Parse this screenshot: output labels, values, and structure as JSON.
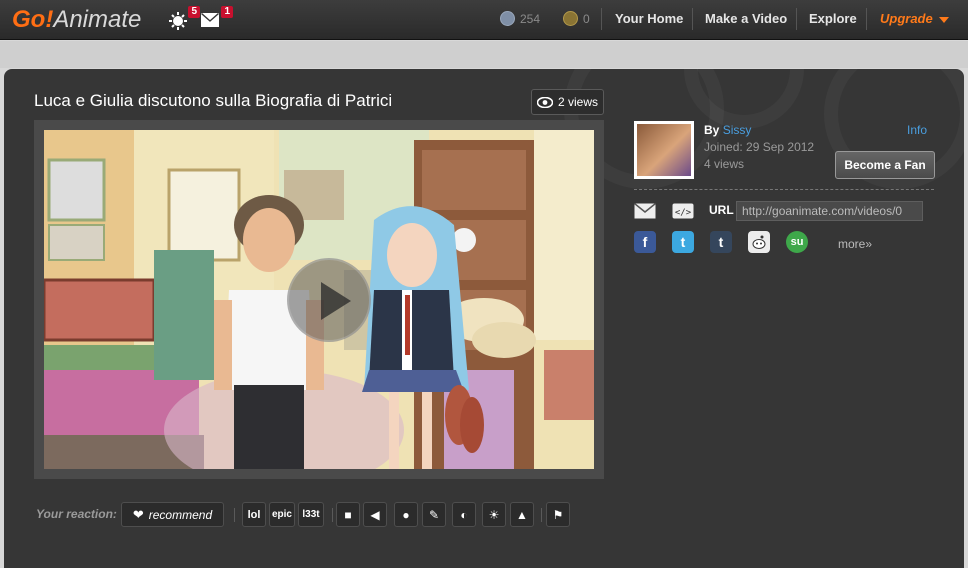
{
  "header": {
    "logo_go": "Go!",
    "logo_animate": "Animate",
    "notifications": {
      "count": "5",
      "icon": "gear-icon"
    },
    "messages": {
      "count": "1",
      "icon": "envelope-icon"
    },
    "gocoins": "254",
    "goPoints": "0",
    "nav": [
      "Your Home",
      "Make a Video",
      "Explore"
    ],
    "upgrade_label": "Upgrade"
  },
  "video": {
    "title": "Luca e Giulia discutono sulla Biografia di Patrici",
    "views_label": "2 views"
  },
  "author": {
    "by_label": "By",
    "name": "Sissy",
    "joined": "Joined: 29 Sep 2012",
    "views": "4 views",
    "info_label": "Info",
    "fan_button": "Become a Fan"
  },
  "share": {
    "url_label": "URL",
    "url_value": "http://goanimate.com/videos/0",
    "more_label": "more»",
    "networks": [
      "facebook",
      "twitter",
      "tumblr",
      "reddit",
      "stumbleupon"
    ]
  },
  "reactions": {
    "label": "Your reaction:",
    "recommend": "recommend",
    "buttons": [
      "lol",
      "epic",
      "l33t"
    ],
    "icons": [
      "camera-icon",
      "speaker-icon",
      "microphone-icon",
      "brush-icon",
      "palette-icon",
      "lightbulb-icon",
      "stamp-icon",
      "flag-icon"
    ]
  },
  "colors": {
    "accent": "#ff7a1a",
    "link": "#4a9fe0",
    "panel": "#363636"
  }
}
